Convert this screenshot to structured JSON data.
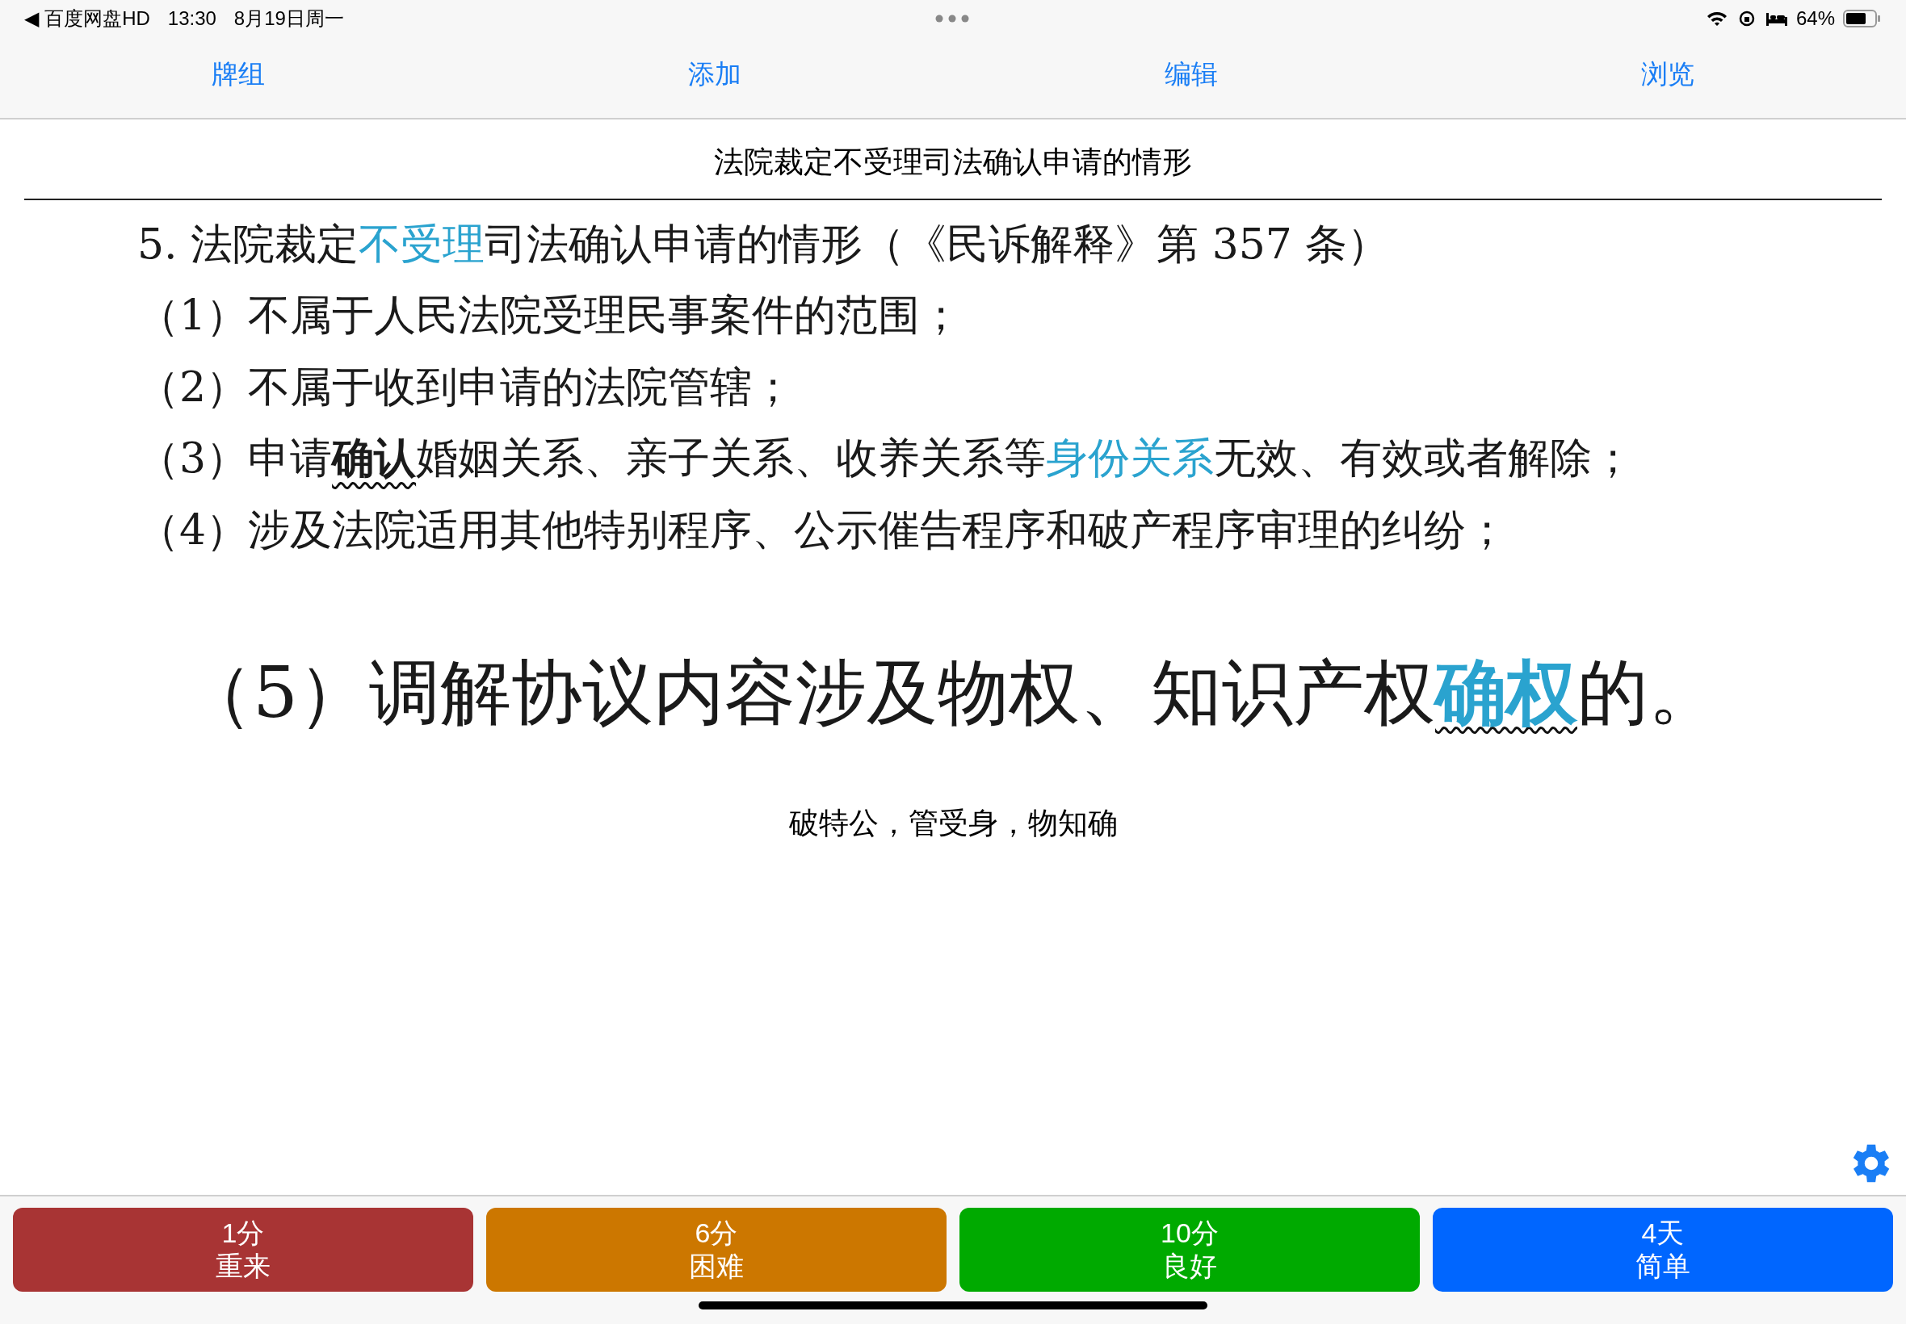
{
  "status_bar": {
    "back_app": "◀ 百度网盘HD",
    "time": "13:30",
    "date": "8月19日周一",
    "battery": "64%"
  },
  "tabs": [
    {
      "label": "牌组"
    },
    {
      "label": "添加"
    },
    {
      "label": "编辑"
    },
    {
      "label": "浏览"
    }
  ],
  "card": {
    "title": "法院裁定不受理司法确认申请的情形",
    "front_lines": [
      {
        "kind": "normal",
        "segments": [
          {
            "text": "5. 法院裁定",
            "kind": "plain"
          },
          {
            "text": "不受理",
            "kind": "accent"
          },
          {
            "text": "司法确认申请的情形（《民诉解释》第 357 条）",
            "kind": "plain"
          }
        ]
      },
      {
        "kind": "normal",
        "segments": [
          {
            "text": "（1）不属于人民法院受理民事案件的范围；",
            "kind": "plain"
          }
        ]
      },
      {
        "kind": "normal",
        "segments": [
          {
            "text": "（2）不属于收到申请的法院管辖；",
            "kind": "plain"
          }
        ]
      },
      {
        "kind": "normal",
        "segments": [
          {
            "text": "（3）申请",
            "kind": "plain"
          },
          {
            "text": "确认",
            "kind": "emphasis"
          },
          {
            "text": "婚姻关系、亲子关系、收养关系等",
            "kind": "plain"
          },
          {
            "text": "身份关系",
            "kind": "accent"
          },
          {
            "text": "无效、有效或者解除；",
            "kind": "plain"
          }
        ]
      },
      {
        "kind": "normal",
        "segments": [
          {
            "text": "（4）涉及法院适用其他特别程序、公示催告程序和破产程序审理的纠纷；",
            "kind": "plain"
          }
        ]
      },
      {
        "kind": "large",
        "segments": [
          {
            "text": "（5）调解协议内容涉及物权、知识产权",
            "kind": "plain"
          },
          {
            "text": "确权",
            "kind": "accent-emphasis"
          },
          {
            "text": "的。",
            "kind": "plain"
          }
        ]
      }
    ],
    "back": "破特公，管受身，物知确"
  },
  "answer_buttons": [
    {
      "interval": "1分",
      "label": "重来",
      "color": "#a83434"
    },
    {
      "interval": "6分",
      "label": "困难",
      "color": "#cc7700"
    },
    {
      "interval": "10分",
      "label": "良好",
      "color": "#00aa00"
    },
    {
      "interval": "4天",
      "label": "简单",
      "color": "#0066ff"
    }
  ]
}
